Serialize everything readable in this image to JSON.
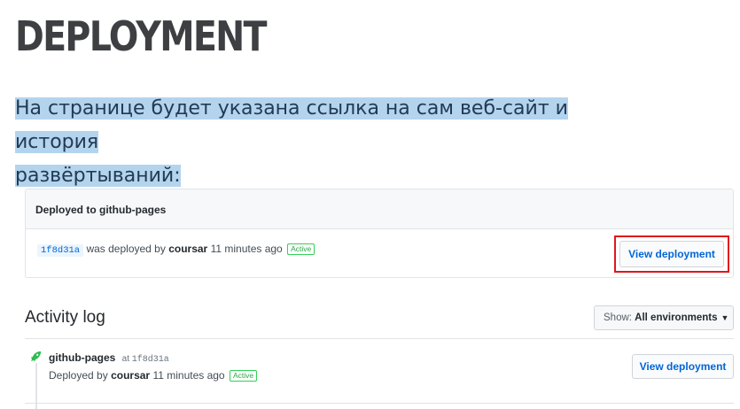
{
  "page": {
    "heading": "DEPLOYMENT",
    "subtitle_line1": "На странице будет указана ссылка на сам веб-сайт и история",
    "subtitle_line2": "развёртываний:"
  },
  "deployment": {
    "header": "Deployed to github-pages",
    "sha": "1f8d31a",
    "deployed_by_text": "was deployed by",
    "user": "coursar",
    "time": "11 minutes ago",
    "status": "Active",
    "view_button": "View deployment"
  },
  "activity": {
    "title": "Activity log",
    "filter_prefix": "Show:",
    "filter_value": "All environments",
    "entries": [
      {
        "environment": "github-pages",
        "at_label": "at",
        "sha": "1f8d31a",
        "deployed_by_label": "Deployed by",
        "user": "coursar",
        "time": "11 minutes ago",
        "status": "Active",
        "view_button": "View deployment"
      }
    ]
  },
  "icons": {
    "entry_icon": "rocket-icon",
    "filter_caret": "caret-down-icon"
  },
  "colors": {
    "link": "#0366d6",
    "active_badge": "#28a745",
    "highlight_frame": "#e0161d",
    "rocket": "#2cbe4e"
  }
}
